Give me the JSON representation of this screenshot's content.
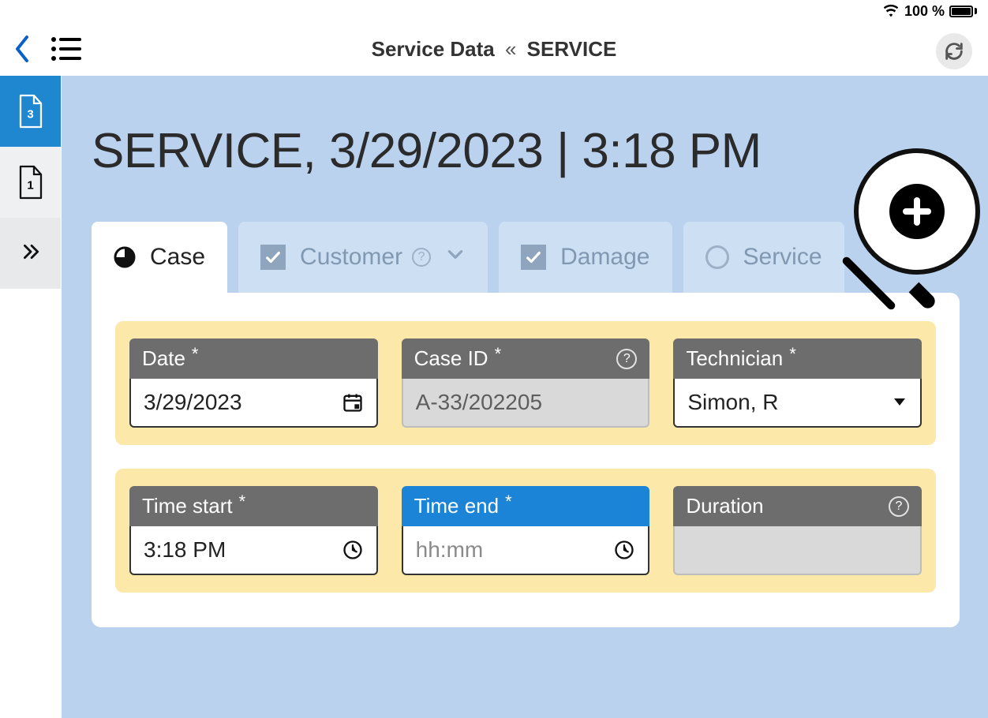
{
  "status": {
    "battery_text": "100 %"
  },
  "header": {
    "title_left": "Service Data",
    "title_sep": "«",
    "title_right": "SERVICE"
  },
  "sidebar": {
    "doc_active_badge": "3",
    "doc_second_badge": "1"
  },
  "page": {
    "heading_service": "SERVICE",
    "heading_rest": ", 3/29/2023 | 3:18 PM"
  },
  "tabs": {
    "case": "Case",
    "customer": "Customer",
    "damage": "Damage",
    "service": "Service"
  },
  "fields": {
    "date_label": "Date",
    "date_value": "3/29/2023",
    "caseid_label": "Case ID",
    "caseid_value": "A-33/202205",
    "tech_label": "Technician",
    "tech_value": "Simon, R",
    "tstart_label": "Time start",
    "tstart_value": "3:18 PM",
    "tend_label": "Time end",
    "tend_placeholder": "hh:mm",
    "duration_label": "Duration"
  },
  "glyphs": {
    "required": "*",
    "question": "?"
  }
}
